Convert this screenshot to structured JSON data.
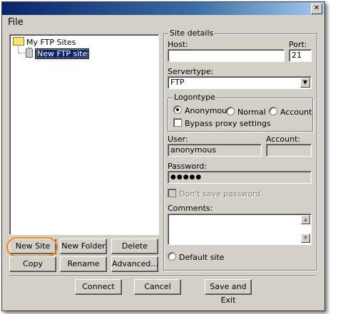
{
  "menu": {
    "file": "File"
  },
  "titlebar": {
    "close_glyph": "✕"
  },
  "tree": {
    "root_label": "My FTP Sites",
    "child_label": "New FTP site"
  },
  "left_buttons": {
    "new_site": "New Site",
    "new_folder": "New Folder",
    "delete": "Delete",
    "copy": "Copy",
    "rename": "Rename",
    "advanced": "Advanced..."
  },
  "site_details": {
    "title": "Site details",
    "host_label": "Host:",
    "host_value": "",
    "port_label": "Port:",
    "port_value": "21",
    "servertype_label": "Servertype:",
    "servertype_value": "FTP",
    "logontype": {
      "title": "Logontype",
      "anonymous": "Anonymous",
      "normal": "Normal",
      "account": "Account",
      "selected": "Anonymous",
      "bypass_proxy": "Bypass proxy settings"
    },
    "user_label": "User:",
    "user_value": "anonymous",
    "account_label": "Account:",
    "account_value": "",
    "password_label": "Password:",
    "password_value": "●●●●●",
    "dont_save_password": "Don't save password.",
    "comments_label": "Comments:",
    "comments_value": "",
    "default_site": "Default site"
  },
  "bottom_buttons": {
    "connect": "Connect",
    "cancel": "Cancel",
    "save_exit": "Save and Exit"
  },
  "colors": {
    "highlight_ring": "#f08a1c",
    "titlebar_dark": "#0a246a",
    "window_face": "#d4d0c8"
  },
  "icons": [
    "close-icon",
    "folder-icon",
    "ftp-site-icon",
    "dropdown-arrow-icon",
    "scroll-up-icon",
    "scroll-down-icon"
  ]
}
